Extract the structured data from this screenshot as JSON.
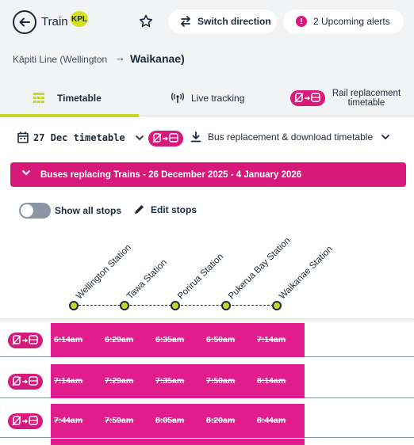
{
  "header": {
    "mode_title": "Train",
    "operator_badge": "KPL",
    "switch_label": "Switch direction",
    "alerts_label": "2 Upcoming alerts",
    "alert_icon_glyph": "!"
  },
  "route": {
    "origin": "Kāpiti Line (Wellington",
    "arrow": "→",
    "destination": "Waikanae)"
  },
  "tabs": [
    {
      "label": "Timetable",
      "selected": true,
      "icon": "timetable-icon"
    },
    {
      "label": "Live tracking",
      "selected": false,
      "icon": "live-tracking-icon"
    },
    {
      "label": "Rail replacement timetable",
      "selected": false,
      "icon": "bus-replacement-icon"
    }
  ],
  "toolbar": {
    "date_label": "27 Dec timetable",
    "download_label": "Bus replacement & download timetable"
  },
  "banner": {
    "text": "Buses replacing Trains - 26 December 2025 - 4 January 2026"
  },
  "options": {
    "show_all_stops_label": "Show all stops",
    "show_all_stops_on": false,
    "edit_stops_label": "Edit stops"
  },
  "stops": [
    "Wellington Station",
    "Tawa Station",
    "Porirua Station",
    "Pukerua Bay Station",
    "Waikanae Station"
  ],
  "trips": [
    {
      "times": [
        "6:14am",
        "6:29am",
        "6:35am",
        "6:50am",
        "7:14am"
      ],
      "cancelled": true
    },
    {
      "times": [
        "7:14am",
        "7:29am",
        "7:35am",
        "7:50am",
        "8:14am"
      ],
      "cancelled": true
    },
    {
      "times": [
        "7:44am",
        "7:59am",
        "8:05am",
        "8:20am",
        "8:44am"
      ],
      "cancelled": true
    }
  ],
  "colors": {
    "accent_green": "#c5d82b",
    "replacement_pink": "#d6197a",
    "text_dark": "#1b2a3a",
    "header_bg": "#f2f3f5"
  }
}
